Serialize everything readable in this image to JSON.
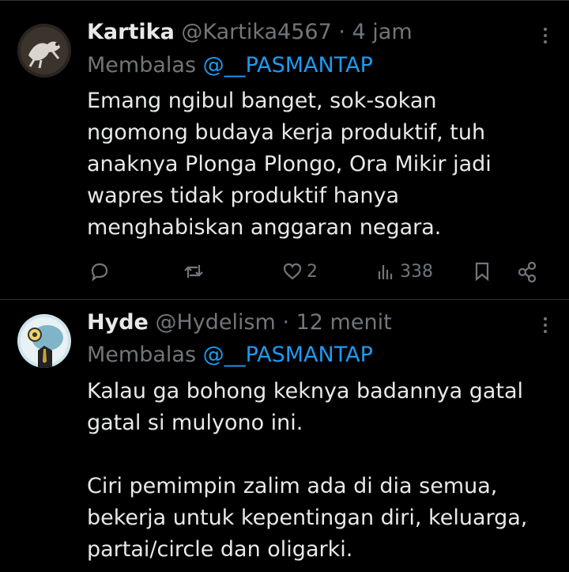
{
  "tweets": [
    {
      "name": "Kartika",
      "handle": "@Kartika4567",
      "time": "· 4 jam",
      "reply_prefix": "Membalas ",
      "reply_to": "@__PASMANTAP",
      "lines": [
        "Emang ngibul banget, sok-sokan",
        "ngomong budaya kerja produktif, tuh",
        "anaknya Plonga Plongo, Ora Mikir jadi",
        "wapres tidak produktif hanya",
        "menghabiskan anggaran negara."
      ],
      "actions": {
        "likes": "2",
        "views": "338"
      }
    },
    {
      "name": "Hyde",
      "handle": "@Hydelism",
      "time": "· 12 menit",
      "reply_prefix": "Membalas ",
      "reply_to": "@__PASMANTAP",
      "lines": [
        "Kalau ga bohong keknya badannya gatal",
        "gatal si mulyono ini.",
        "",
        "Ciri pemimpin zalim ada di dia semua,",
        "bekerja untuk kepentingan diri, keluarga,",
        "partai/circle dan oligarki."
      ]
    }
  ],
  "colors": {
    "background": "#000000",
    "text": "#e7e9ea",
    "muted": "#71767b",
    "mention": "#1d9bf0"
  }
}
